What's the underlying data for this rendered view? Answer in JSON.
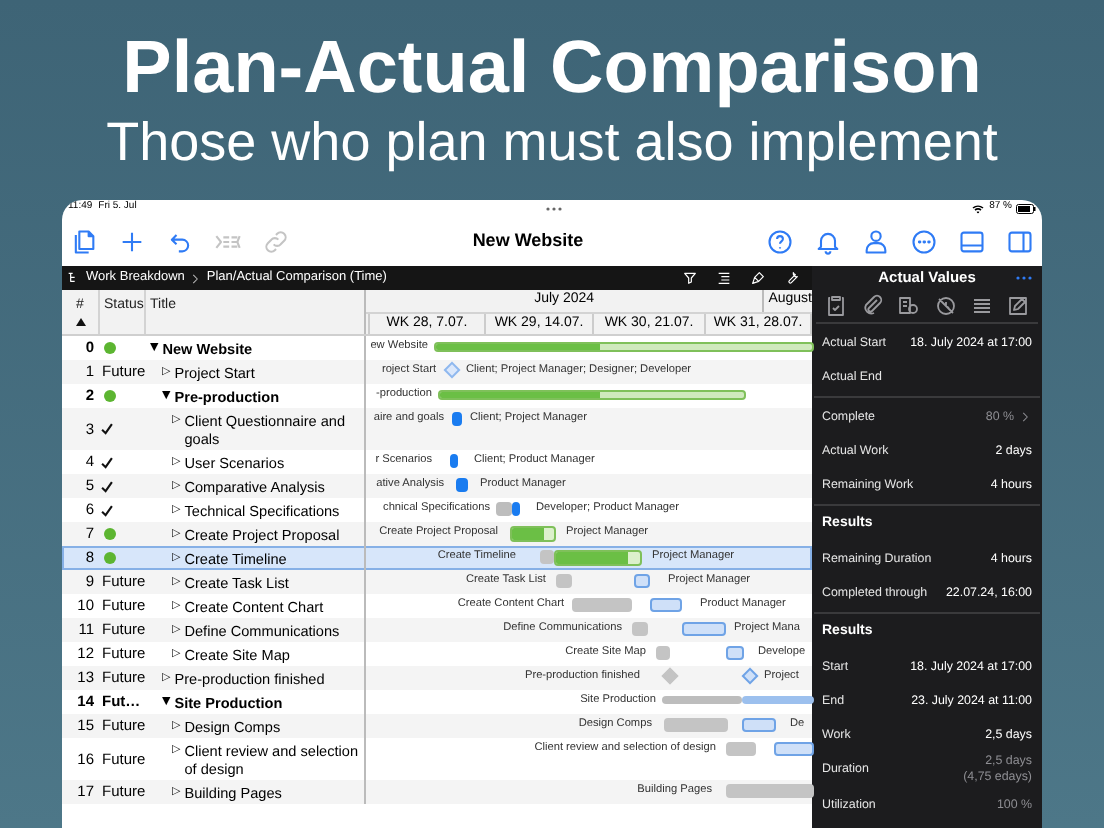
{
  "headline": {
    "title": "Plan-Actual Comparison",
    "subtitle": "Those who plan must also implement"
  },
  "status_bar": {
    "time": "11:49",
    "date": "Fri 5. Jul",
    "battery": "87 %"
  },
  "toolbar": {
    "title": "New Website",
    "left": [
      {
        "kind": "document",
        "disabled": false
      },
      {
        "kind": "plus",
        "disabled": false
      },
      {
        "kind": "undo",
        "disabled": false
      },
      {
        "kind": "indent",
        "disabled": true
      },
      {
        "kind": "link",
        "disabled": true
      }
    ],
    "right": [
      {
        "kind": "help"
      },
      {
        "kind": "bell"
      },
      {
        "kind": "person"
      },
      {
        "kind": "ellipsis"
      },
      {
        "kind": "panel_bottom"
      },
      {
        "kind": "panel_right"
      }
    ]
  },
  "breadcrumb": [
    "Work Breakdown",
    "Plan/Actual Comparison (Time)"
  ],
  "table": {
    "columns": [
      "#",
      "Status",
      "Title"
    ],
    "month_headers": [
      "July 2024",
      "August"
    ],
    "weeks": [
      "WK 28, 7.07.",
      "WK 29, 14.07.",
      "WK 30, 21.07.",
      "WK 31, 28.07."
    ],
    "rows": [
      {
        "number": "0",
        "kind": "in_progress",
        "toggle": "▼",
        "title": "New Website",
        "summary": true,
        "selected": false,
        "bar_label": "ew Website",
        "children": [
          {
            "number": "1",
            "kind": "future",
            "status_text": "Future",
            "toggle": "▷",
            "title": "Project Start",
            "summary": false,
            "selected": false,
            "bar_label": "roject Start",
            "resources": "Client; Project Manager; Designer; Developer"
          },
          {
            "number": "2",
            "kind": "in_progress",
            "toggle": "▼",
            "title": "Pre-production",
            "summary": true,
            "selected": false,
            "bar_label": "-production",
            "children": [
              {
                "number": "3",
                "kind": "done",
                "toggle": "▷",
                "title": "Client Questionnaire and goals",
                "summary": false,
                "selected": false,
                "bar_label": "aire and goals",
                "resources": "Client; Project Manager"
              },
              {
                "number": "4",
                "kind": "done",
                "toggle": "▷",
                "title": "User Scenarios",
                "summary": false,
                "selected": false,
                "bar_label": "r Scenarios",
                "resources": "Client; Product Manager"
              },
              {
                "number": "5",
                "kind": "done",
                "toggle": "▷",
                "title": "Comparative Analysis",
                "summary": false,
                "selected": false,
                "bar_label": "ative Analysis",
                "resources": "Product Manager"
              },
              {
                "number": "6",
                "kind": "done",
                "toggle": "▷",
                "title": "Technical Specifications",
                "summary": false,
                "selected": false,
                "bar_label": "chnical Specifications",
                "resources": "Developer; Product Manager"
              },
              {
                "number": "7",
                "kind": "in_progress",
                "toggle": "▷",
                "title": "Create Project Proposal",
                "summary": false,
                "selected": false,
                "bar_label": "Create Project Proposal",
                "resources": "Project Manager"
              },
              {
                "number": "8",
                "kind": "in_progress",
                "toggle": "▷",
                "title": "Create Timeline",
                "summary": false,
                "selected": true,
                "bar_label": "Create Timeline",
                "resources": "Project Manager"
              },
              {
                "number": "9",
                "kind": "future",
                "status_text": "Future",
                "toggle": "▷",
                "title": "Create Task List",
                "summary": false,
                "selected": false,
                "bar_label": "Create Task List",
                "resources": "Project Manager"
              },
              {
                "number": "10",
                "kind": "future",
                "status_text": "Future",
                "toggle": "▷",
                "title": "Create Content Chart",
                "summary": false,
                "selected": false,
                "bar_label": "Create Content Chart",
                "resources": "Product Manager"
              },
              {
                "number": "11",
                "kind": "future",
                "status_text": "Future",
                "toggle": "▷",
                "title": "Define Communications",
                "summary": false,
                "selected": false,
                "bar_label": "Define Communications",
                "resources": "Project Mana"
              },
              {
                "number": "12",
                "kind": "future",
                "status_text": "Future",
                "toggle": "▷",
                "title": "Create Site Map",
                "summary": false,
                "selected": false,
                "bar_label": "Create Site Map",
                "resources": "Develope"
              }
            ]
          },
          {
            "number": "13",
            "kind": "future",
            "status_text": "Future",
            "toggle": "▷",
            "title": "Pre-production finished",
            "summary": false,
            "selected": false,
            "bar_label": "Pre-production finished",
            "resources": "Project"
          },
          {
            "number": "14",
            "kind": "future",
            "status_text": "Fut…",
            "toggle": "▼",
            "title": "Site Production",
            "summary": true,
            "selected": false,
            "bar_label": "Site Production",
            "children": [
              {
                "number": "15",
                "kind": "future",
                "status_text": "Future",
                "toggle": "▷",
                "title": "Design Comps",
                "summary": false,
                "selected": false,
                "bar_label": "Design Comps",
                "resources": "De"
              },
              {
                "number": "16",
                "kind": "future",
                "status_text": "Future",
                "toggle": "▷",
                "title": "Client review and selection of design",
                "summary": false,
                "selected": false,
                "bar_label": "Client review and selection of design"
              },
              {
                "number": "17",
                "kind": "future",
                "status_text": "Future",
                "toggle": "▷",
                "title": "Building Pages",
                "summary": false,
                "selected": false,
                "bar_label": "Building Pages"
              }
            ]
          }
        ]
      }
    ]
  },
  "panel": {
    "title": "Actual Values",
    "sections": [
      {
        "rows": [
          {
            "label": "Actual Start",
            "value": "18. July 2024 at 17:00"
          },
          {
            "label": "Actual End"
          }
        ]
      },
      {
        "rows": [
          {
            "label": "Complete",
            "value": "80 %",
            "muted": true,
            "chevron": true
          },
          {
            "label": "Actual Work",
            "value": "2 days"
          },
          {
            "label": "Remaining Work",
            "value": "4 hours"
          }
        ]
      },
      {
        "title": "Results",
        "rows": [
          {
            "label": "Remaining Duration",
            "value": "4 hours"
          },
          {
            "label": "Completed through",
            "value": "22.07.24, 16:00"
          }
        ]
      },
      {
        "title": "Results",
        "rows": [
          {
            "label": "Start",
            "value": "18. July 2024 at 17:00"
          },
          {
            "label": "End",
            "value": "23. July 2024 at 11:00"
          },
          {
            "label": "Work",
            "value": "2,5 days"
          },
          {
            "label": "Duration",
            "value": "2,5 days",
            "note": "(4,75 edays)",
            "muted": true
          },
          {
            "label": "Utilization",
            "value": "100 %",
            "muted": true
          }
        ]
      }
    ]
  }
}
